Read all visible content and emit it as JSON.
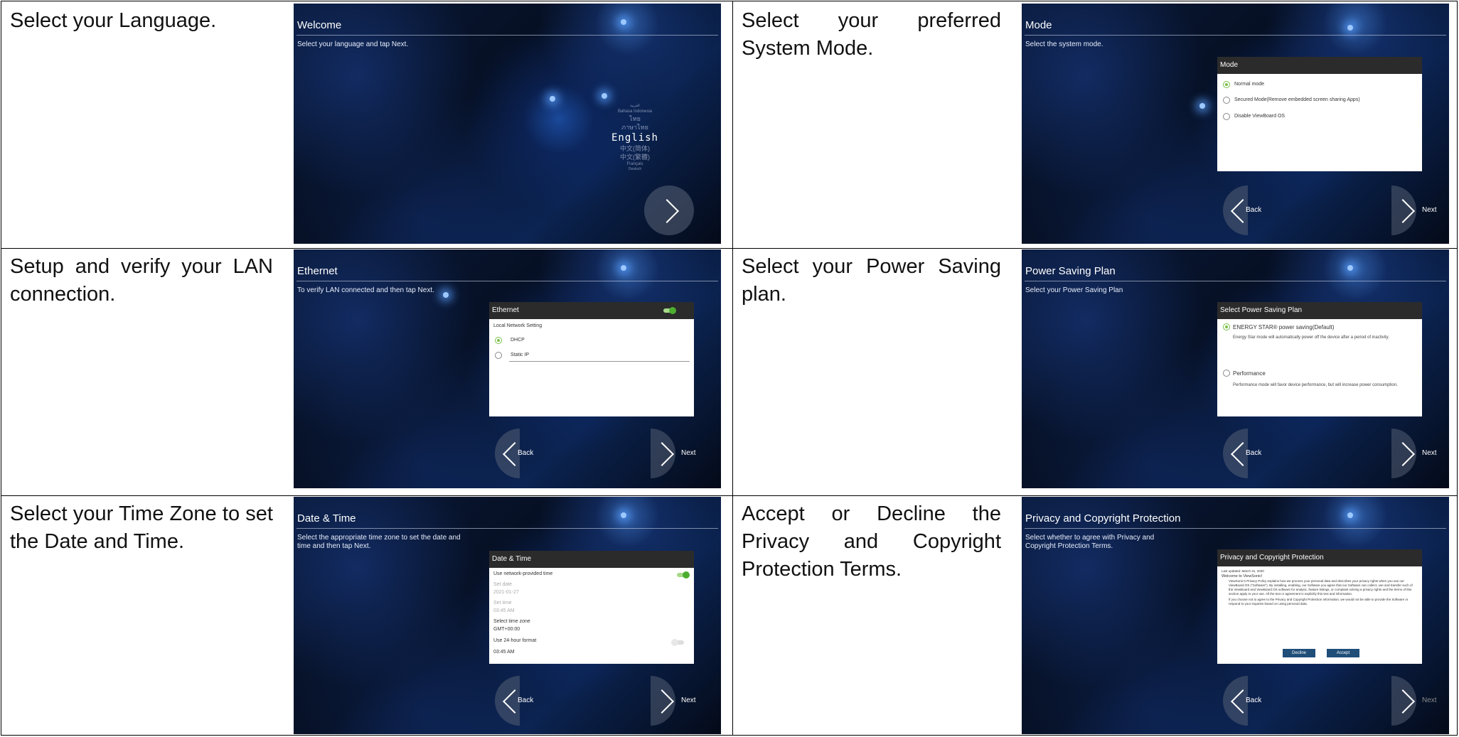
{
  "rows": [
    {
      "left": {
        "caption": "Select your Language.",
        "screen": {
          "title": "Welcome",
          "subtitle": "Select your language and tap Next.",
          "languages_above": [
            "العربية",
            "Bahasa Indonesia",
            "ไทย",
            "ภาษาไทย"
          ],
          "selected_language": "English",
          "languages_below": [
            "中文(简体)",
            "中文(繁體)",
            "Français",
            "Deutsch"
          ]
        }
      },
      "right": {
        "caption": "Select your preferred System Mode.",
        "screen": {
          "title": "Mode",
          "subtitle": "Select the system mode.",
          "dialog_title": "Mode",
          "options": [
            "Normal mode",
            "Secured Mode(Remove embedded screen sharing Apps)",
            "Disable ViewBoard OS"
          ],
          "back_label": "Back",
          "next_label": "Next"
        }
      }
    },
    {
      "left": {
        "caption": "Setup and verify your LAN connection.",
        "screen": {
          "title": "Ethernet",
          "subtitle": "To verify LAN connected and then tap Next.",
          "dialog_title": "Ethernet",
          "section_label": "Local Network Setting",
          "options": [
            "DHCP",
            "Static IP"
          ],
          "back_label": "Back",
          "next_label": "Next"
        }
      },
      "right": {
        "caption": "Select your Power Saving plan.",
        "screen": {
          "title": "Power Saving Plan",
          "subtitle": "Select your Power Saving Plan",
          "dialog_title": "Select Power Saving Plan",
          "option1_label": "ENERGY STAR® power saving(Default)",
          "option1_desc": "Energy Star mode will automatically power off the device after a period of inactivity.",
          "option2_label": "Performance",
          "option2_desc": "Performance mode will favor device performance, but will increase power consumption.",
          "back_label": "Back",
          "next_label": "Next"
        }
      }
    },
    {
      "left": {
        "caption": "Select your Time Zone to set the Date and Time.",
        "screen": {
          "title": "Date & Time",
          "subtitle": "Select the appropriate time zone to set the date and time and then tap Next.",
          "dialog_title": "Date & Time",
          "network_time_label": "Use network-provided time",
          "set_date_label": "Set date",
          "set_date_value": "2021-01-27",
          "set_time_label": "Set time",
          "set_time_value": "03:45 AM",
          "timezone_label": "Select time zone",
          "timezone_value": "GMT+00:00",
          "format_label": "Use 24-hour format",
          "format_value": "03:45 AM",
          "back_label": "Back",
          "next_label": "Next"
        }
      },
      "right": {
        "caption": "Accept or Decline the Privacy and Copyright Protection Terms.",
        "screen": {
          "title": "Privacy and Copyright Protection",
          "subtitle": "Select whether to agree with Privacy and Copyright Protection Terms.",
          "dialog_title": "Privacy and Copyright Protection",
          "updated": "Last updated: March 31, 2020",
          "welcome": "Welcome to ViewSonic!",
          "body1": "ViewSonic's Privacy Policy explains how we process your personal data and describes your privacy rights when you use our ViewBoard OS (\"Software\"). By installing, enabling, our Software you agree that our Software can collect, use and transfer such of the ViewBoard and ViewBoard OS software for analytic, feature listings, or complaint solving a privacy rights and the terms of this section apply to your use. All the text or agreement is explicitly this text and information.",
          "body2": "If you choose not to agree to the Privacy and Copyright Protection information, we would not be able to provide the Software or respond to your inquiries based on using personal data.",
          "decline_label": "Decline",
          "accept_label": "Accept",
          "back_label": "Back",
          "next_label": "Next"
        }
      }
    }
  ]
}
